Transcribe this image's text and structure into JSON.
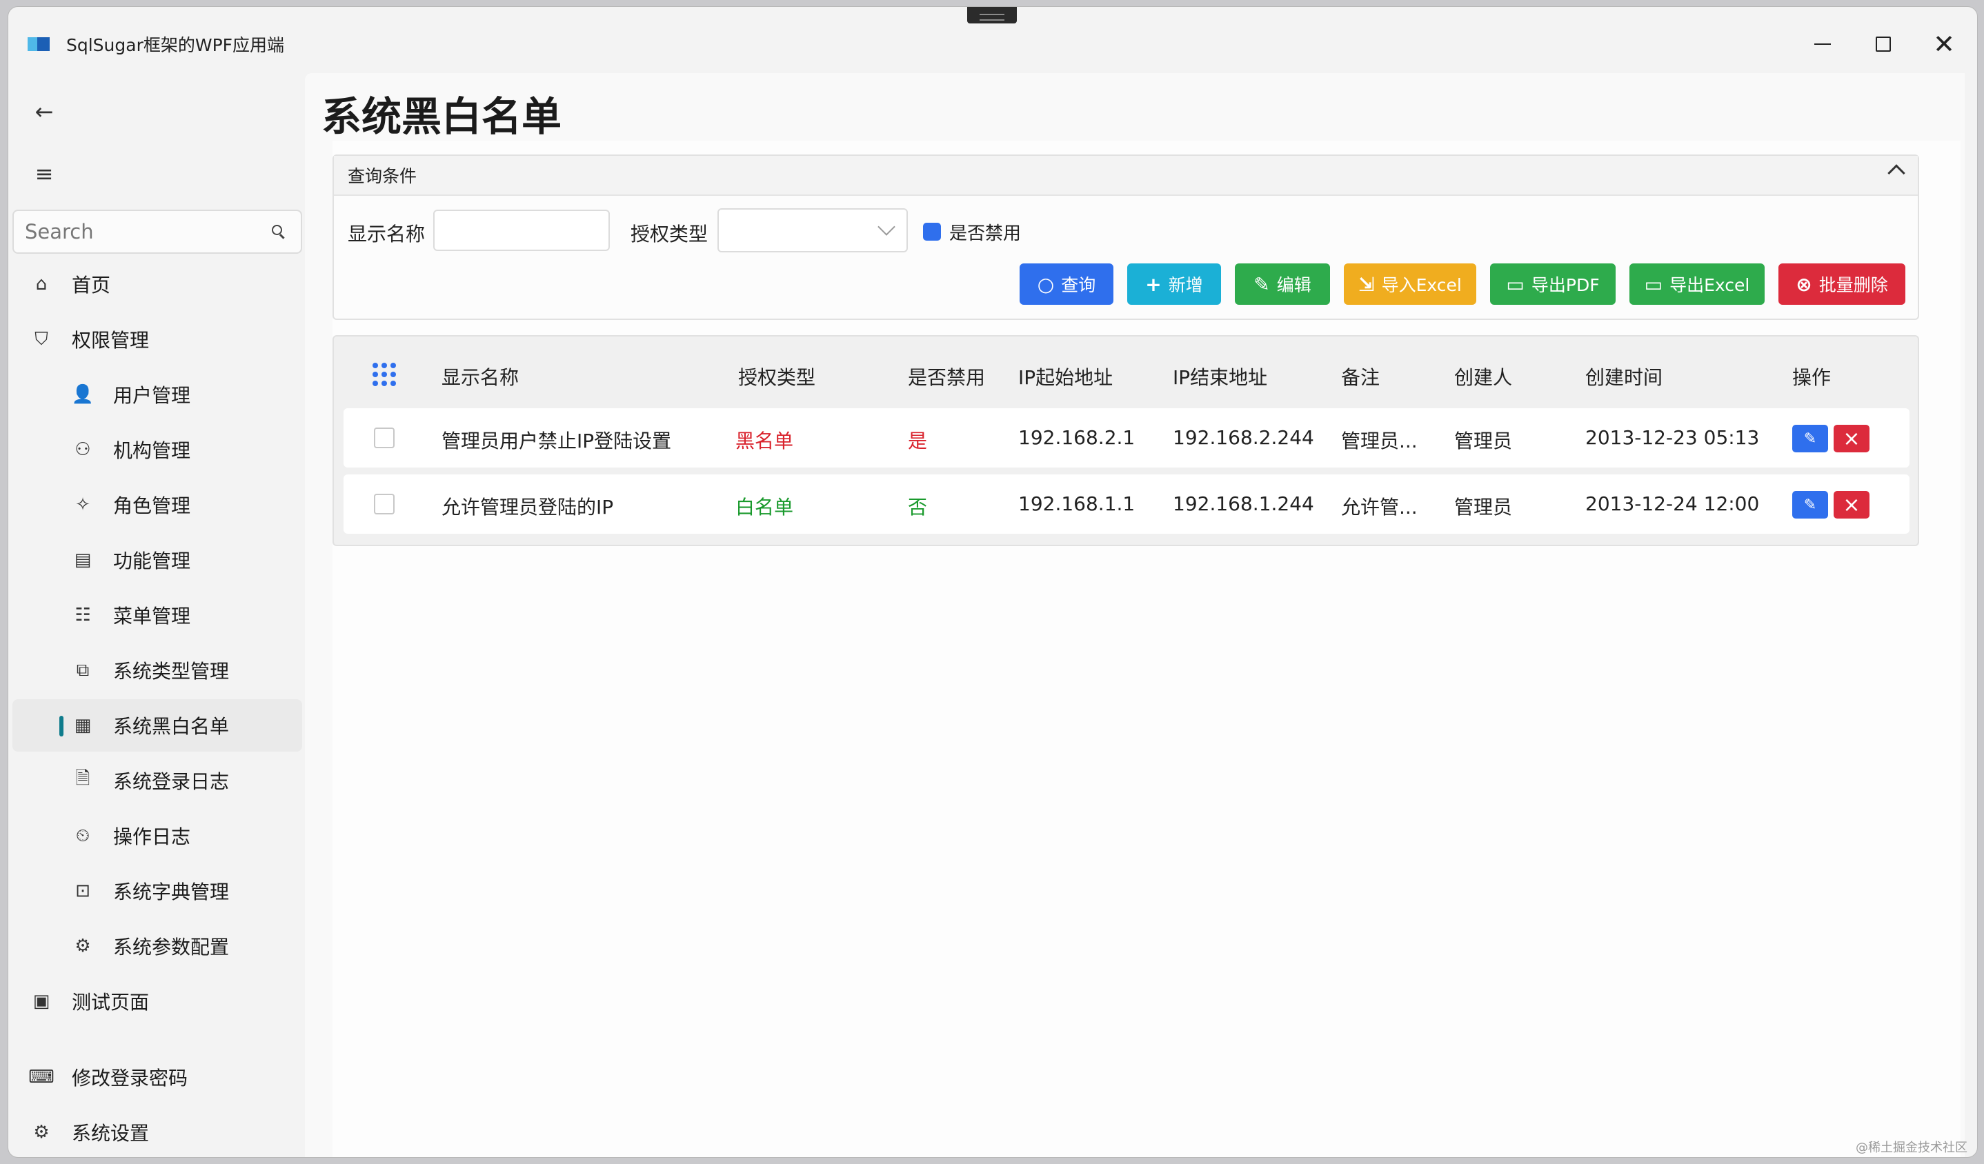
{
  "window": {
    "title": "SqlSugar框架的WPF应用端",
    "minimize_icon": "minimize-icon",
    "maximize_icon": "maximize-icon",
    "close_glyph": "✕"
  },
  "nav": {
    "back_glyph": "←",
    "menu_glyph": "≡",
    "search": {
      "placeholder": "Search"
    },
    "items": [
      {
        "label": "首页",
        "icon": "home-icon",
        "glyph": "⌂",
        "level": "top"
      },
      {
        "label": "权限管理",
        "icon": "shield-user-icon",
        "glyph": "⛉",
        "level": "top"
      },
      {
        "label": "用户管理",
        "icon": "user-lock-icon",
        "glyph": "👤",
        "level": "sub"
      },
      {
        "label": "机构管理",
        "icon": "org-tree-icon",
        "glyph": "⚇",
        "level": "sub"
      },
      {
        "label": "角色管理",
        "icon": "role-icon",
        "glyph": "✧",
        "level": "sub"
      },
      {
        "label": "功能管理",
        "icon": "clipboard-icon",
        "glyph": "▤",
        "level": "sub"
      },
      {
        "label": "菜单管理",
        "icon": "menu-list-icon",
        "glyph": "☷",
        "level": "sub"
      },
      {
        "label": "系统类型管理",
        "icon": "type-check-icon",
        "glyph": "⧉",
        "level": "sub"
      },
      {
        "label": "系统黑白名单",
        "icon": "blacklist-icon",
        "glyph": "▦",
        "level": "sub",
        "selected": true
      },
      {
        "label": "系统登录日志",
        "icon": "log-file-icon",
        "glyph": "🗎",
        "level": "sub"
      },
      {
        "label": "操作日志",
        "icon": "clock-log-icon",
        "glyph": "⏲",
        "level": "sub"
      },
      {
        "label": "系统字典管理",
        "icon": "dictionary-icon",
        "glyph": "⊡",
        "level": "sub"
      },
      {
        "label": "系统参数配置",
        "icon": "settings-doc-icon",
        "glyph": "⚙",
        "level": "sub"
      },
      {
        "label": "测试页面",
        "icon": "test-page-icon",
        "glyph": "▣",
        "level": "top"
      }
    ],
    "footer_items": [
      {
        "label": "修改登录密码",
        "icon": "password-icon",
        "glyph": "⌨"
      },
      {
        "label": "系统设置",
        "icon": "gear-icon",
        "glyph": "⚙"
      }
    ]
  },
  "page": {
    "title": "系统黑白名单"
  },
  "query": {
    "header": "查询条件",
    "display_name_label": "显示名称",
    "display_name_value": "",
    "auth_type_label": "授权类型",
    "auth_type_value": "",
    "forbidden_label": "是否禁用",
    "forbidden_checked": true
  },
  "toolbar": {
    "query": "查询",
    "add": "新增",
    "edit": "编辑",
    "import_excel": "导入Excel",
    "export_pdf": "导出PDF",
    "export_excel": "导出Excel",
    "batch_delete": "批量删除"
  },
  "table": {
    "columns": [
      "显示名称",
      "授权类型",
      "是否禁用",
      "IP起始地址",
      "IP结束地址",
      "备注",
      "创建人",
      "创建时间",
      "操作"
    ],
    "rows": [
      {
        "name": "管理员用户禁止IP登陆设置",
        "auth_type": "黑名单",
        "forbidden": "是",
        "ip_start": "192.168.2.1",
        "ip_end": "192.168.2.244",
        "note": "管理员...",
        "creator": "管理员",
        "created": "2013-12-23 05:13"
      },
      {
        "name": "允许管理员登陆的IP",
        "auth_type": "白名单",
        "forbidden": "否",
        "ip_start": "192.168.1.1",
        "ip_end": "192.168.1.244",
        "note": "允许管...",
        "creator": "管理员",
        "created": "2013-12-24 12:00"
      }
    ]
  },
  "colors": {
    "primary": "#2f6fed",
    "info": "#1bb0d6",
    "success": "#2eab4c",
    "warning": "#f0ad1f",
    "danger": "#dc2b3c",
    "nav_indicator": "#0f7c8c"
  },
  "watermark": "@稀土掘金技术社区"
}
